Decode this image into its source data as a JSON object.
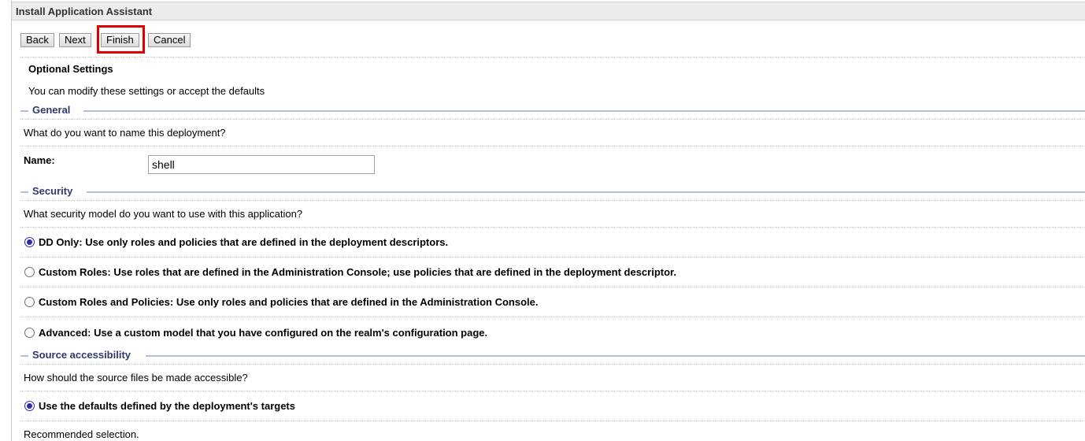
{
  "window": {
    "title": "Install Application Assistant"
  },
  "toolbar": {
    "back_label": "Back",
    "next_label": "Next",
    "finish_label": "Finish",
    "cancel_label": "Cancel"
  },
  "page": {
    "heading": "Optional Settings",
    "description": "You can modify these settings or accept the defaults"
  },
  "general": {
    "section_title": "General",
    "question": "What do you want to name this deployment?",
    "name_label": "Name:",
    "name_value": "shell"
  },
  "security": {
    "section_title": "Security",
    "question": "What security model do you want to use with this application?",
    "options": [
      {
        "label": "DD Only: Use only roles and policies that are defined in the deployment descriptors.",
        "selected": true
      },
      {
        "label": "Custom Roles: Use roles that are defined in the Administration Console; use policies that are defined in the deployment descriptor.",
        "selected": false
      },
      {
        "label": "Custom Roles and Policies: Use only roles and policies that are defined in the Administration Console.",
        "selected": false
      },
      {
        "label": "Advanced: Use a custom model that you have configured on the realm's configuration page.",
        "selected": false
      }
    ]
  },
  "source": {
    "section_title": "Source accessibility",
    "question": "How should the source files be made accessible?",
    "options": [
      {
        "label": "Use the defaults defined by the deployment's targets",
        "selected": true
      }
    ],
    "note": "Recommended selection."
  }
}
